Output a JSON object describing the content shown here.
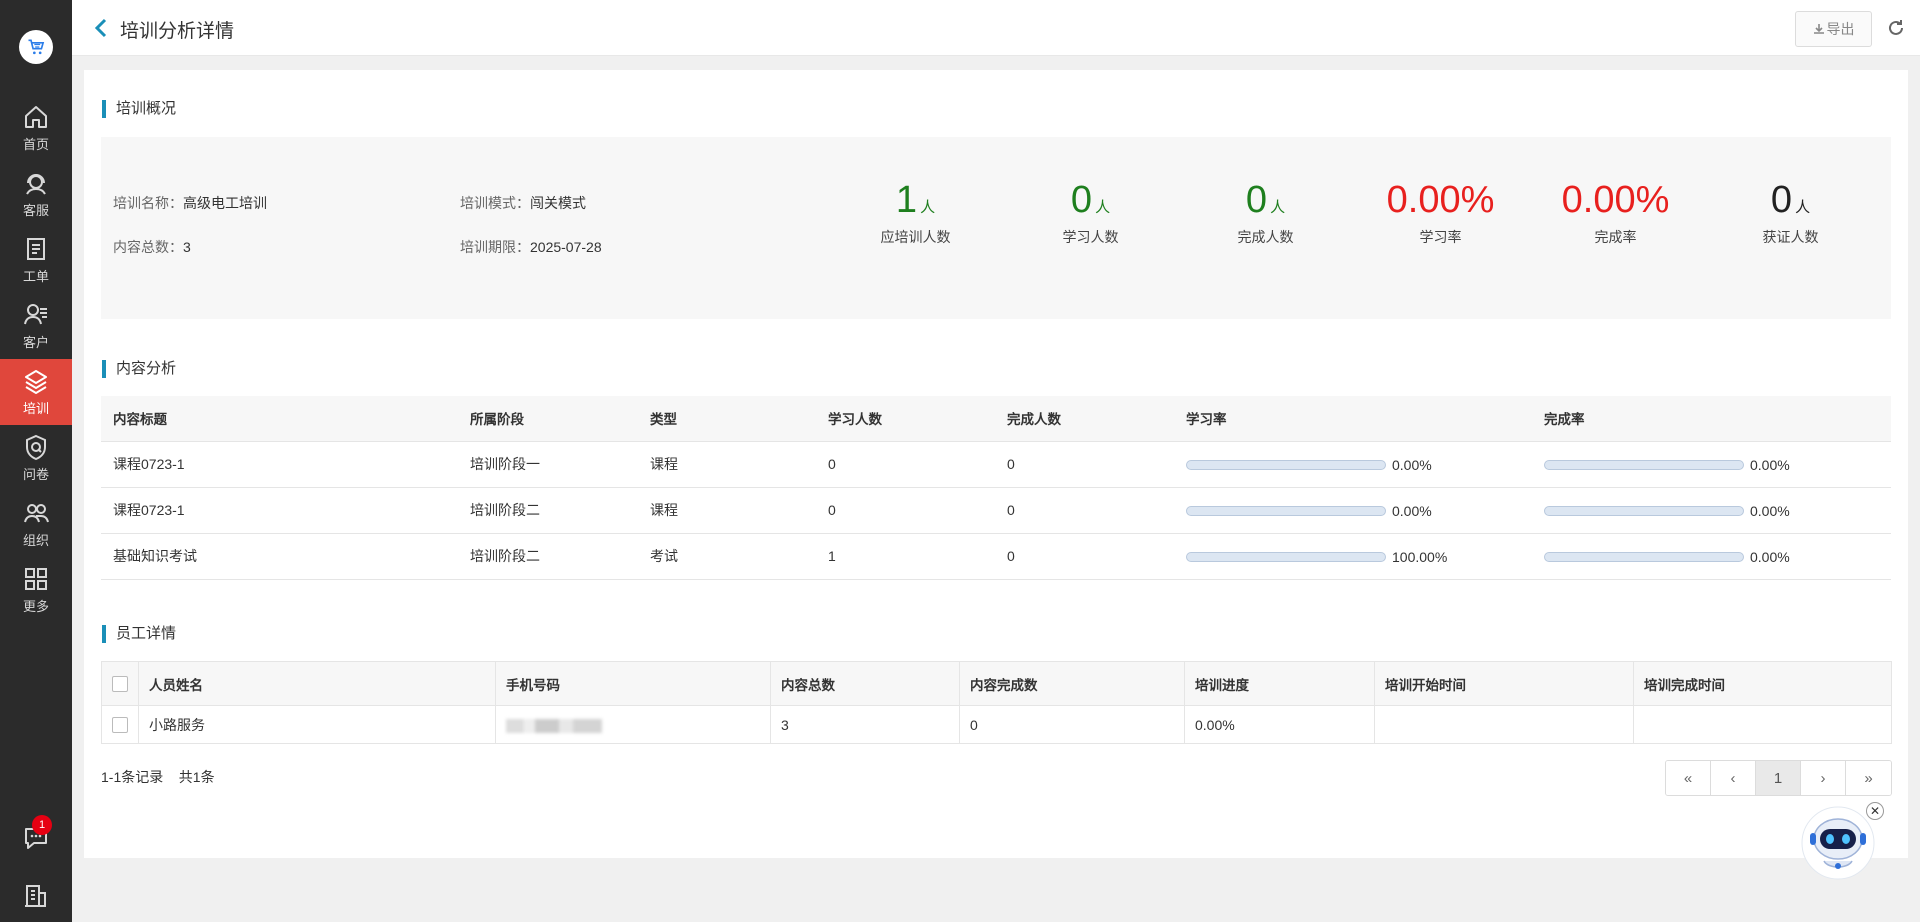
{
  "sidebar": {
    "items": [
      {
        "label": "首页",
        "icon": "home-icon"
      },
      {
        "label": "客服",
        "icon": "headset-icon"
      },
      {
        "label": "工单",
        "icon": "clipboard-icon"
      },
      {
        "label": "客户",
        "icon": "customer-icon"
      },
      {
        "label": "培训",
        "icon": "layers-icon"
      },
      {
        "label": "问卷",
        "icon": "survey-shield-icon"
      },
      {
        "label": "组织",
        "icon": "group-icon"
      },
      {
        "label": "更多",
        "icon": "grid-icon"
      }
    ],
    "chat_badge": "1"
  },
  "header": {
    "title": "培训分析详情",
    "export_label": "导出"
  },
  "overview": {
    "section_title": "培训概况",
    "name_label": "培训名称：",
    "name_value": "高级电工培训",
    "mode_label": "培训模式：",
    "mode_value": "闯关模式",
    "content_count_label": "内容总数：",
    "content_count_value": "3",
    "deadline_label": "培训期限：",
    "deadline_value": "2025-07-28",
    "stats": [
      {
        "value": "1",
        "unit": "人",
        "label": "应培训人数",
        "color": "#1e7f1e"
      },
      {
        "value": "0",
        "unit": "人",
        "label": "学习人数",
        "color": "#1e7f1e"
      },
      {
        "value": "0",
        "unit": "人",
        "label": "完成人数",
        "color": "#1e7f1e"
      },
      {
        "value": "0.00%",
        "unit": "",
        "label": "学习率",
        "color": "#e8201e"
      },
      {
        "value": "0.00%",
        "unit": "",
        "label": "完成率",
        "color": "#e8201e"
      },
      {
        "value": "0",
        "unit": "人",
        "label": "获证人数",
        "color": "#222222"
      }
    ]
  },
  "content_analysis": {
    "section_title": "内容分析",
    "columns": [
      "内容标题",
      "所属阶段",
      "类型",
      "学习人数",
      "完成人数",
      "学习率",
      "完成率"
    ],
    "rows": [
      {
        "title": "课程0723-1",
        "stage": "培训阶段一",
        "type": "课程",
        "learners": "0",
        "completers": "0",
        "learn_rate": "0.00%",
        "learn_rate_value": 0,
        "complete_rate": "0.00%",
        "complete_rate_value": 0
      },
      {
        "title": "课程0723-1",
        "stage": "培训阶段二",
        "type": "课程",
        "learners": "0",
        "completers": "0",
        "learn_rate": "0.00%",
        "learn_rate_value": 0,
        "complete_rate": "0.00%",
        "complete_rate_value": 0
      },
      {
        "title": "基础知识考试",
        "stage": "培训阶段二",
        "type": "考试",
        "learners": "1",
        "completers": "0",
        "learn_rate": "100.00%",
        "learn_rate_value": 100,
        "complete_rate": "0.00%",
        "complete_rate_value": 0
      }
    ]
  },
  "employees": {
    "section_title": "员工详情",
    "columns": [
      "人员姓名",
      "手机号码",
      "内容总数",
      "内容完成数",
      "培训进度",
      "培训开始时间",
      "培训完成时间"
    ],
    "rows": [
      {
        "name": "小路服务",
        "content_total": "3",
        "content_done": "0",
        "progress": "0.00%",
        "start": "",
        "end": ""
      }
    ],
    "records_text": "1-1条记录",
    "total_text": "共1条"
  },
  "pagination": {
    "first": "«",
    "prev": "‹",
    "current": "1",
    "next": "›",
    "last": "»"
  },
  "colors": {
    "sidebar_bg": "#2b2b2b",
    "active_nav": "#e0473c",
    "accent": "#1a8fb8",
    "progress_fill": "#4e86e0"
  }
}
